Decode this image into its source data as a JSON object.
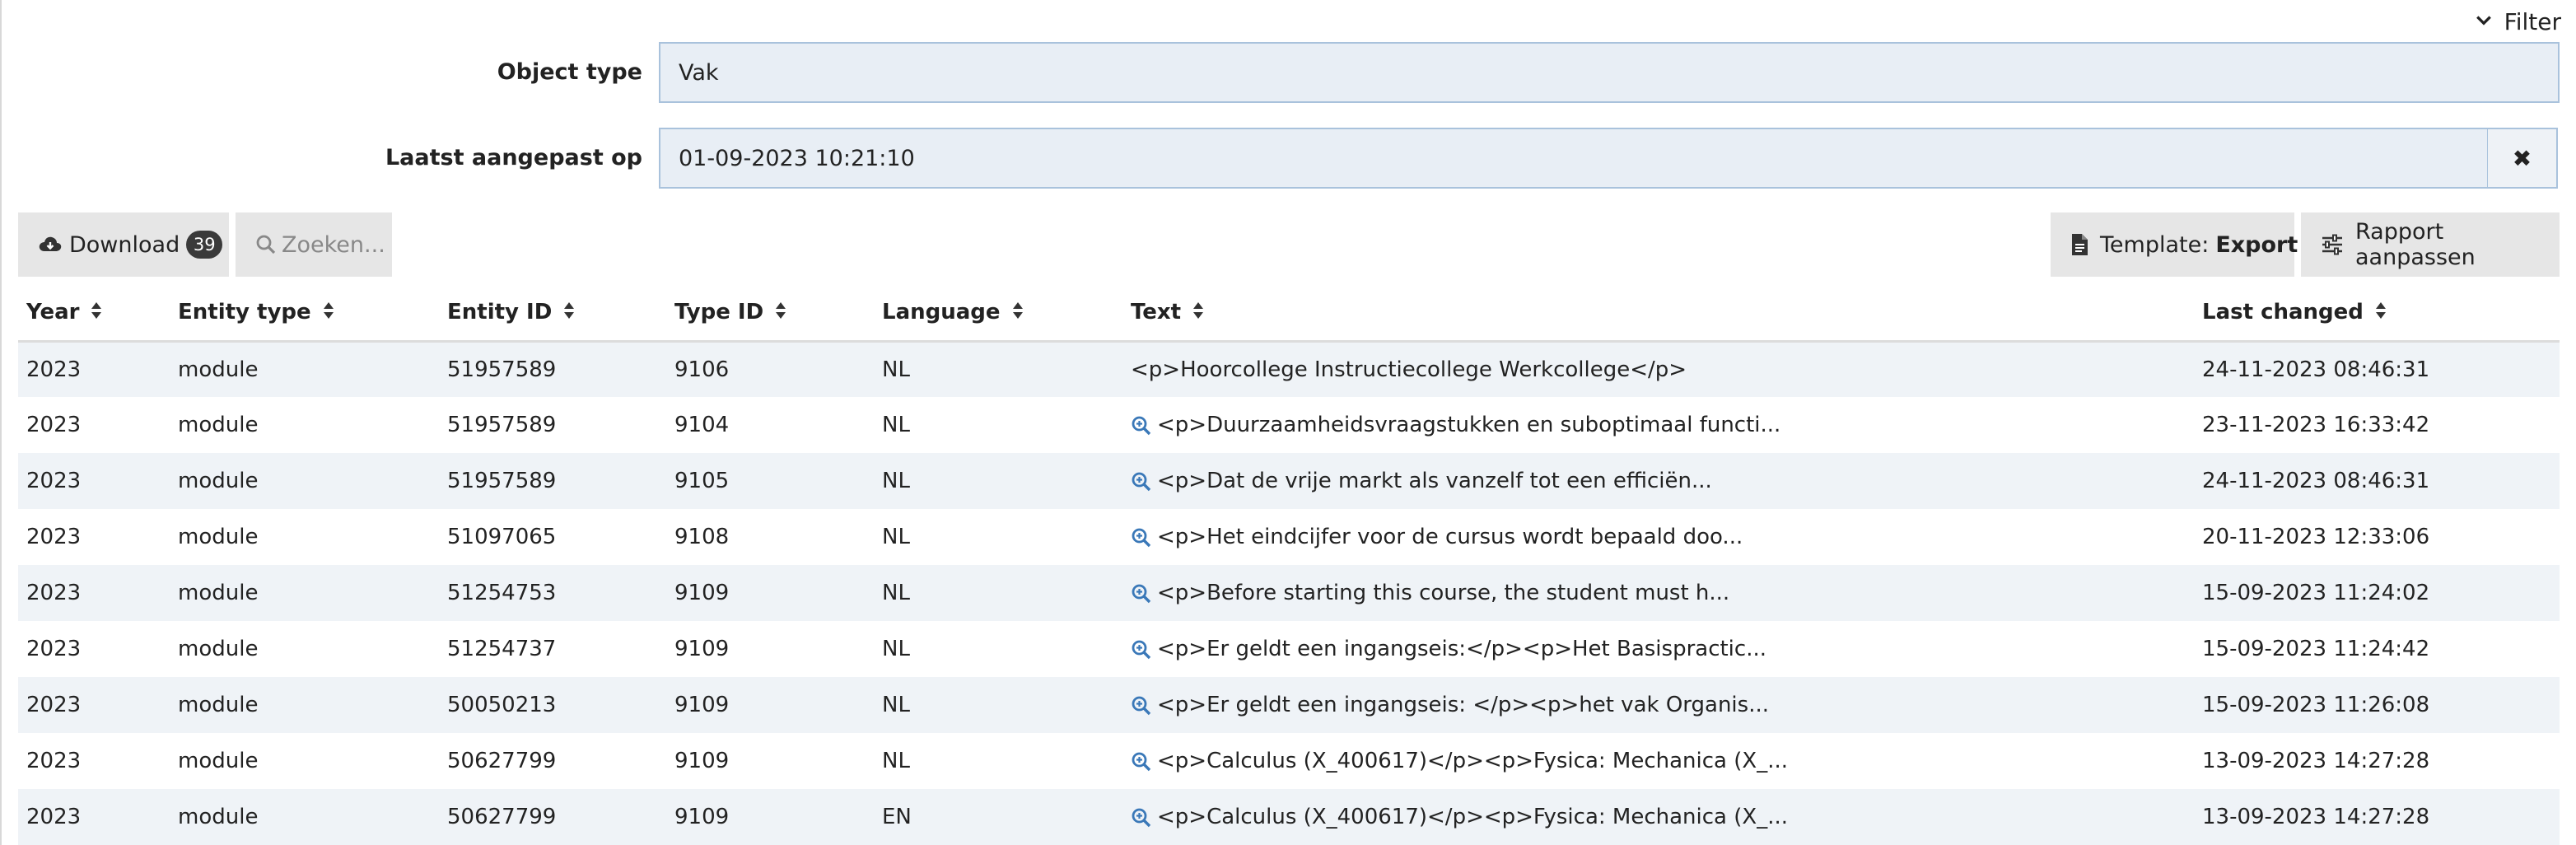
{
  "filter_toggle": {
    "label": "Filter"
  },
  "filters": [
    {
      "label": "Object type",
      "value": "Vak"
    },
    {
      "label": "Laatst aangepast op",
      "value": "01-09-2023 10:21:10"
    }
  ],
  "toolbar": {
    "download_label": "Download",
    "download_count": "39",
    "search_placeholder": "Zoeken...",
    "template_prefix": "Template:",
    "template_name": "Export",
    "report_label": "Rapport aanpassen"
  },
  "table": {
    "columns": [
      "Year",
      "Entity type",
      "Entity ID",
      "Type ID",
      "Language",
      "Text",
      "Last changed"
    ],
    "rows": [
      {
        "year": "2023",
        "entity_type": "module",
        "entity_id": "51957589",
        "type_id": "9106",
        "language": "NL",
        "text": "<p>Hoorcollege Instructiecollege Werkcollege</p>",
        "preview": false,
        "last_changed": "24-11-2023 08:46:31"
      },
      {
        "year": "2023",
        "entity_type": "module",
        "entity_id": "51957589",
        "type_id": "9104",
        "language": "NL",
        "text": "<p>Duurzaamheidsvraagstukken en suboptimaal functi...",
        "preview": true,
        "last_changed": "23-11-2023 16:33:42"
      },
      {
        "year": "2023",
        "entity_type": "module",
        "entity_id": "51957589",
        "type_id": "9105",
        "language": "NL",
        "text": "<p>Dat de vrije markt als vanzelf tot een efficiën...",
        "preview": true,
        "last_changed": "24-11-2023 08:46:31"
      },
      {
        "year": "2023",
        "entity_type": "module",
        "entity_id": "51097065",
        "type_id": "9108",
        "language": "NL",
        "text": "<p>Het eindcijfer voor de cursus wordt bepaald doo...",
        "preview": true,
        "last_changed": "20-11-2023 12:33:06"
      },
      {
        "year": "2023",
        "entity_type": "module",
        "entity_id": "51254753",
        "type_id": "9109",
        "language": "NL",
        "text": "<p>Before starting this course, the student must h...",
        "preview": true,
        "last_changed": "15-09-2023 11:24:02"
      },
      {
        "year": "2023",
        "entity_type": "module",
        "entity_id": "51254737",
        "type_id": "9109",
        "language": "NL",
        "text": "<p>Er geldt een ingangseis:</p><p>Het Basispractic...",
        "preview": true,
        "last_changed": "15-09-2023 11:24:42"
      },
      {
        "year": "2023",
        "entity_type": "module",
        "entity_id": "50050213",
        "type_id": "9109",
        "language": "NL",
        "text": "<p>Er geldt een ingangseis: </p><p>het vak Organis...",
        "preview": true,
        "last_changed": "15-09-2023 11:26:08"
      },
      {
        "year": "2023",
        "entity_type": "module",
        "entity_id": "50627799",
        "type_id": "9109",
        "language": "NL",
        "text": "<p>Calculus (X_400617)</p><p>Fysica: Mechanica (X_...",
        "preview": true,
        "last_changed": "13-09-2023 14:27:28"
      },
      {
        "year": "2023",
        "entity_type": "module",
        "entity_id": "50627799",
        "type_id": "9109",
        "language": "EN",
        "text": "<p>Calculus (X_400617)</p><p>Fysica: Mechanica (X_...",
        "preview": true,
        "last_changed": "13-09-2023 14:27:28"
      }
    ]
  },
  "colors": {
    "accent": "#3a78b8",
    "field_bg": "#e8eef5",
    "field_border": "#a9c2dc",
    "row_alt": "#eff3f7"
  }
}
